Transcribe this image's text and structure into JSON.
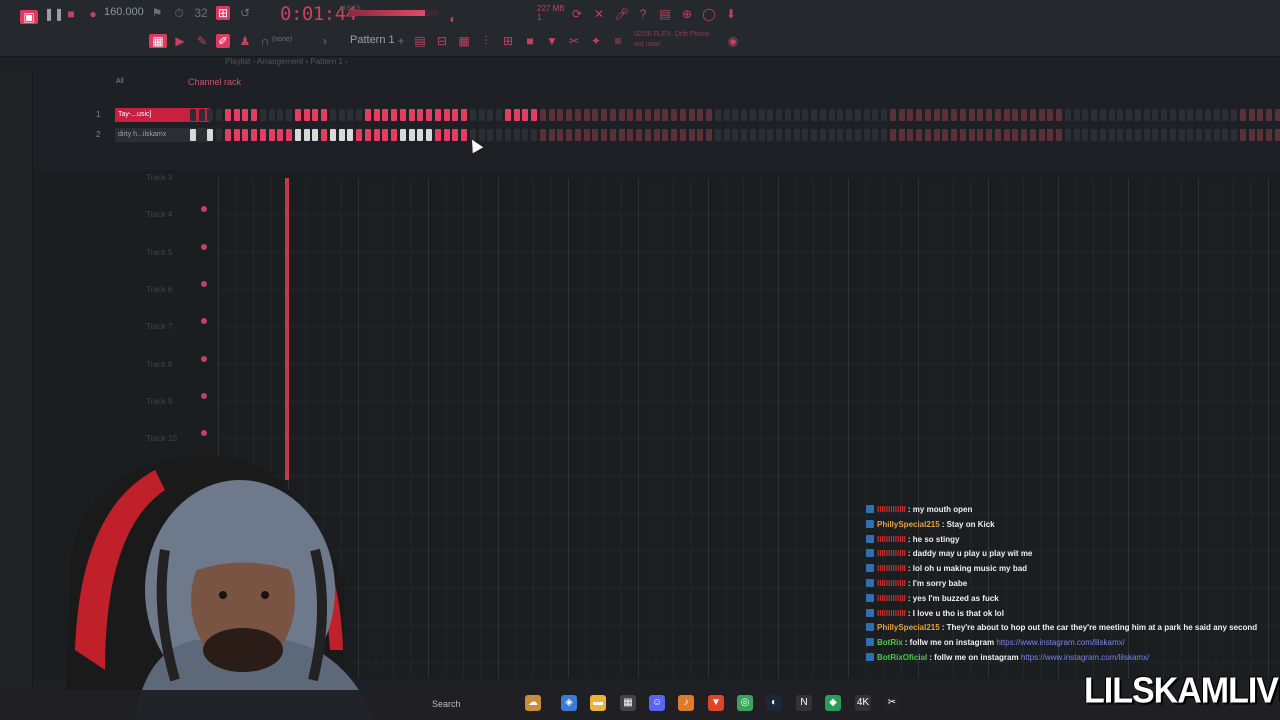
{
  "toolbar": {
    "tempo": "160.000",
    "time": "0:01",
    "time_frac": "44",
    "time_unit": "M:S:CS",
    "master_volume": 0.85,
    "cpu_label": "227 MB",
    "cpu_value": "1",
    "pattern": "Pattern 1",
    "pattern_mode": "(none)",
    "hint_line1": "02/26  FLEX: Drift Phonk",
    "hint_line2": "out now!"
  },
  "breadcrumb": "Playlist - Arrangement › Pattern 1 ›",
  "channel_rack": {
    "title": "Channel rack",
    "filter": "All",
    "channels": [
      {
        "num": "1",
        "name": "Tay-...usic]",
        "selected": true
      },
      {
        "num": "2",
        "name": "dirty h...ilskamx",
        "selected": false
      }
    ]
  },
  "playlist": {
    "tracks": [
      "Track 3",
      "Track 4",
      "Track 5",
      "Track 6",
      "Track 7",
      "Track 8",
      "Track 9",
      "Track 10"
    ]
  },
  "chat": [
    {
      "user": "lllllllllllll",
      "color": "#d92d2d",
      "msg": ": my mouth open",
      "link": ""
    },
    {
      "user": "PhillySpecial215",
      "color": "#e8a23a",
      "msg": ": Stay on Kick",
      "link": ""
    },
    {
      "user": "lllllllllllll",
      "color": "#d92d2d",
      "msg": ": he so stingy",
      "link": ""
    },
    {
      "user": "lllllllllllll",
      "color": "#d92d2d",
      "msg": ": daddy may u play u play wit me",
      "link": ""
    },
    {
      "user": "lllllllllllll",
      "color": "#d92d2d",
      "msg": ": lol oh u making music my bad",
      "link": ""
    },
    {
      "user": "lllllllllllll",
      "color": "#d92d2d",
      "msg": ": I'm sorry babe",
      "link": ""
    },
    {
      "user": "lllllllllllll",
      "color": "#d92d2d",
      "msg": ": yes I'm buzzed as fuck",
      "link": ""
    },
    {
      "user": "lllllllllllll",
      "color": "#d92d2d",
      "msg": ": I love u tho is that ok lol",
      "link": ""
    },
    {
      "user": "PhillySpecial215",
      "color": "#e8a23a",
      "msg": ": They're about to hop out the car they're meeting him at a park he said any second",
      "link": ""
    },
    {
      "user": "BotRix",
      "color": "#47c947",
      "msg": ": follw me on instagram ",
      "link": "https://www.instagram.com/lilskamx/"
    },
    {
      "user": "BotRixOficial",
      "color": "#47c947",
      "msg": ": follw me on instagram ",
      "link": "https://www.instagram.com/lilskamx/"
    }
  ],
  "taskbar": {
    "search": "Search"
  },
  "stream_logo": "LILSKAMLIVE"
}
